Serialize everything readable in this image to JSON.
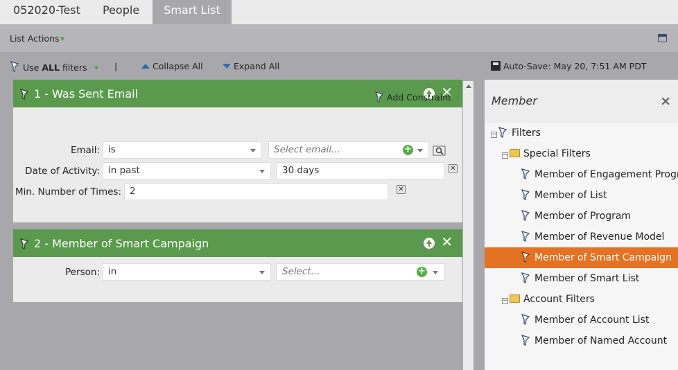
{
  "tabs": [
    {
      "label": "052020-Test"
    },
    {
      "label": "People"
    },
    {
      "label": "Smart List"
    }
  ],
  "actions": {
    "list_actions_label": "List Actions"
  },
  "toolbar": {
    "use_prefix": "Use",
    "use_bold": "ALL",
    "use_suffix": "filters",
    "separator": "|",
    "collapse_all": "Collapse All",
    "expand_all": "Expand All",
    "autosave": "Auto-Save: May 20, 7:51 AM PDT"
  },
  "filters": [
    {
      "title": "1 - Was Sent Email",
      "add_constraint_label": "Add Constraint",
      "email_label": "Email:",
      "email_operator": "is",
      "email_placeholder": "Select email...",
      "date_label": "Date of Activity:",
      "date_operator": "in past",
      "date_value": "30 days",
      "times_label": "Min. Number of Times:",
      "times_value": "2"
    },
    {
      "title": "2 - Member of Smart Campaign",
      "person_label": "Person:",
      "person_operator": "in",
      "person_placeholder": "Select..."
    }
  ],
  "palette": {
    "title": "Member",
    "close_label": "×",
    "tree": {
      "root": "Filters",
      "groups": [
        {
          "label": "Special Filters",
          "items": [
            "Member of Engagement Program",
            "Member of List",
            "Member of Program",
            "Member of Revenue Model",
            "Member of Smart Campaign",
            "Member of Smart List"
          ]
        },
        {
          "label": "Account Filters",
          "items": [
            "Member of Account List",
            "Member of Named Account"
          ]
        }
      ],
      "selected": "Member of Smart Campaign"
    }
  },
  "colors": {
    "panel_header": "#5a9a4c",
    "selected_row": "#e57122",
    "background": "#a8a8ac"
  }
}
